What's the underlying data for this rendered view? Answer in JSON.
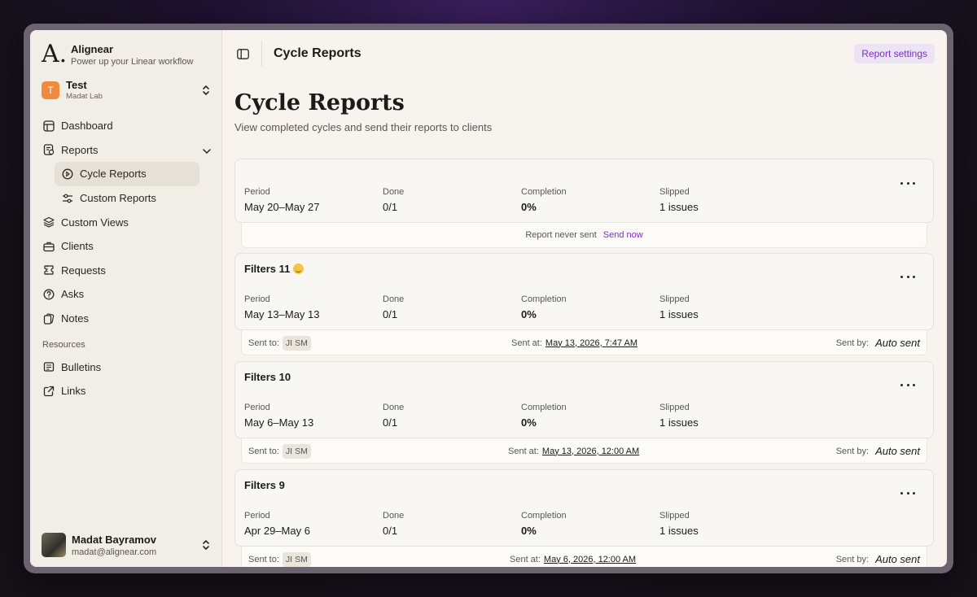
{
  "app": {
    "logo": "A.",
    "name": "Alignear",
    "tagline": "Power up your Linear workflow"
  },
  "workspace": {
    "initial": "T",
    "name": "Test",
    "org": "Madat Lab"
  },
  "nav": {
    "dashboard": "Dashboard",
    "reports": "Reports",
    "cycle_reports": "Cycle Reports",
    "custom_reports": "Custom Reports",
    "custom_views": "Custom Views",
    "clients": "Clients",
    "requests": "Requests",
    "asks": "Asks",
    "notes": "Notes",
    "resources_label": "Resources",
    "bulletins": "Bulletins",
    "links": "Links"
  },
  "user": {
    "name": "Madat Bayramov",
    "email": "madat@alignear.com"
  },
  "header": {
    "title": "Cycle Reports",
    "settings_button": "Report settings"
  },
  "page": {
    "heading": "Cycle Reports",
    "subheading": "View completed cycles and send their reports to clients"
  },
  "labels": {
    "period": "Period",
    "done": "Done",
    "completion": "Completion",
    "slipped": "Slipped",
    "sent_to": "Sent to:",
    "sent_at": "Sent at:",
    "sent_by": "Sent by:"
  },
  "cycles": [
    {
      "title": "",
      "period": "May 20–May 27",
      "done": "0/1",
      "completion": "0%",
      "slipped": "1 issues",
      "never_sent_text": "Report never sent",
      "send_now": "Send now"
    },
    {
      "title": "Filters 11",
      "emoji": "grinning-face-icon",
      "period": "May 13–May 13",
      "done": "0/1",
      "completion": "0%",
      "slipped": "1 issues",
      "recipients": [
        "JI",
        "SM"
      ],
      "sent_at": "May 13, 2026, 7:47 AM",
      "sent_by": "Auto sent"
    },
    {
      "title": "Filters 10",
      "period": "May 6–May 13",
      "done": "0/1",
      "completion": "0%",
      "slipped": "1 issues",
      "recipients": [
        "JI",
        "SM"
      ],
      "sent_at": "May 13, 2026, 12:00 AM",
      "sent_by": "Auto sent"
    },
    {
      "title": "Filters 9",
      "period": "Apr 29–May 6",
      "done": "0/1",
      "completion": "0%",
      "slipped": "1 issues",
      "recipients": [
        "JI",
        "SM"
      ],
      "sent_at": "May 6, 2026, 12:00 AM",
      "sent_by": "Auto sent"
    }
  ],
  "colors": {
    "accent": "#7a2fc4",
    "accent_bg": "#ece3f4",
    "workspace_avatar": "#f08a3c",
    "background": "#f7f4ef",
    "sidebar": "#f1ede7"
  }
}
